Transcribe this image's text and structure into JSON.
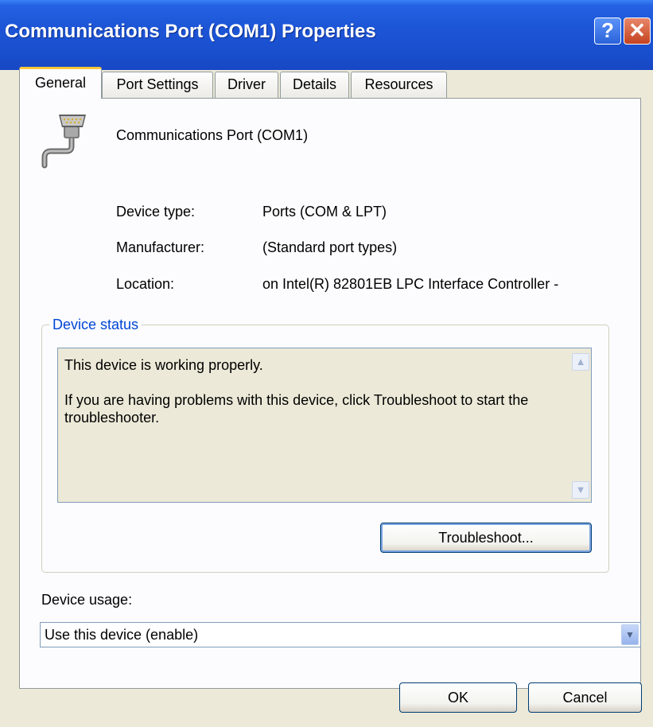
{
  "window": {
    "title": "Communications Port (COM1) Properties",
    "help_glyph": "?",
    "close_glyph": "✕"
  },
  "tabs": [
    {
      "label": "General",
      "active": true
    },
    {
      "label": "Port Settings",
      "active": false
    },
    {
      "label": "Driver",
      "active": false
    },
    {
      "label": "Details",
      "active": false
    },
    {
      "label": "Resources",
      "active": false
    }
  ],
  "device": {
    "icon": "serial-port-icon",
    "name": "Communications Port (COM1)",
    "properties": [
      {
        "label": "Device type:",
        "value": "Ports (COM & LPT)"
      },
      {
        "label": "Manufacturer:",
        "value": "(Standard port types)"
      },
      {
        "label": "Location:",
        "value": "on Intel(R) 82801EB LPC Interface Controller -"
      }
    ]
  },
  "device_status": {
    "legend": "Device status",
    "lines": [
      "This device is working properly.",
      "If you are having problems with this device, click Troubleshoot to start the troubleshooter."
    ],
    "troubleshoot_label": "Troubleshoot..."
  },
  "device_usage": {
    "label": "Device usage:",
    "selected": "Use this device (enable)"
  },
  "buttons": {
    "ok": "OK",
    "cancel": "Cancel"
  },
  "colors": {
    "titlebar": "#1C55D6",
    "dialog_face": "#ECE9D8",
    "group_legend": "#0046D5",
    "tab_highlight": "#FFC83C"
  }
}
